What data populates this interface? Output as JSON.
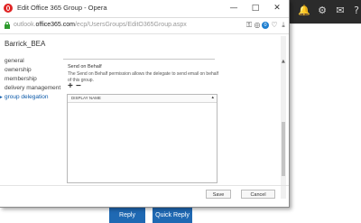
{
  "browser": {
    "window_title": "Edit Office 365 Group - Opera",
    "url_prefix": "outlook.",
    "url_host": "office365.com",
    "url_path": "/ecp/UsersGroups/EditO365Group.aspx",
    "badge_count": "0",
    "minimize_glyph": "—",
    "maximize_glyph": "□",
    "close_glyph": "✕"
  },
  "page": {
    "group_name": "Barrick_BEA",
    "nav": [
      "general",
      "ownership",
      "membership",
      "delivery management",
      "group delegation"
    ],
    "section_title": "Send on Behalf",
    "section_description": "The Send on Behalf permission allows the delegate to send email on behalf of this group.",
    "add_glyph": "+",
    "remove_glyph": "−",
    "list_header": "DISPLAY NAME",
    "save_label": "Save",
    "cancel_label": "Cancel"
  },
  "background": {
    "reply_label": "Reply",
    "quick_reply_label": "Quick Reply",
    "accent_color": "#1f69b3"
  }
}
